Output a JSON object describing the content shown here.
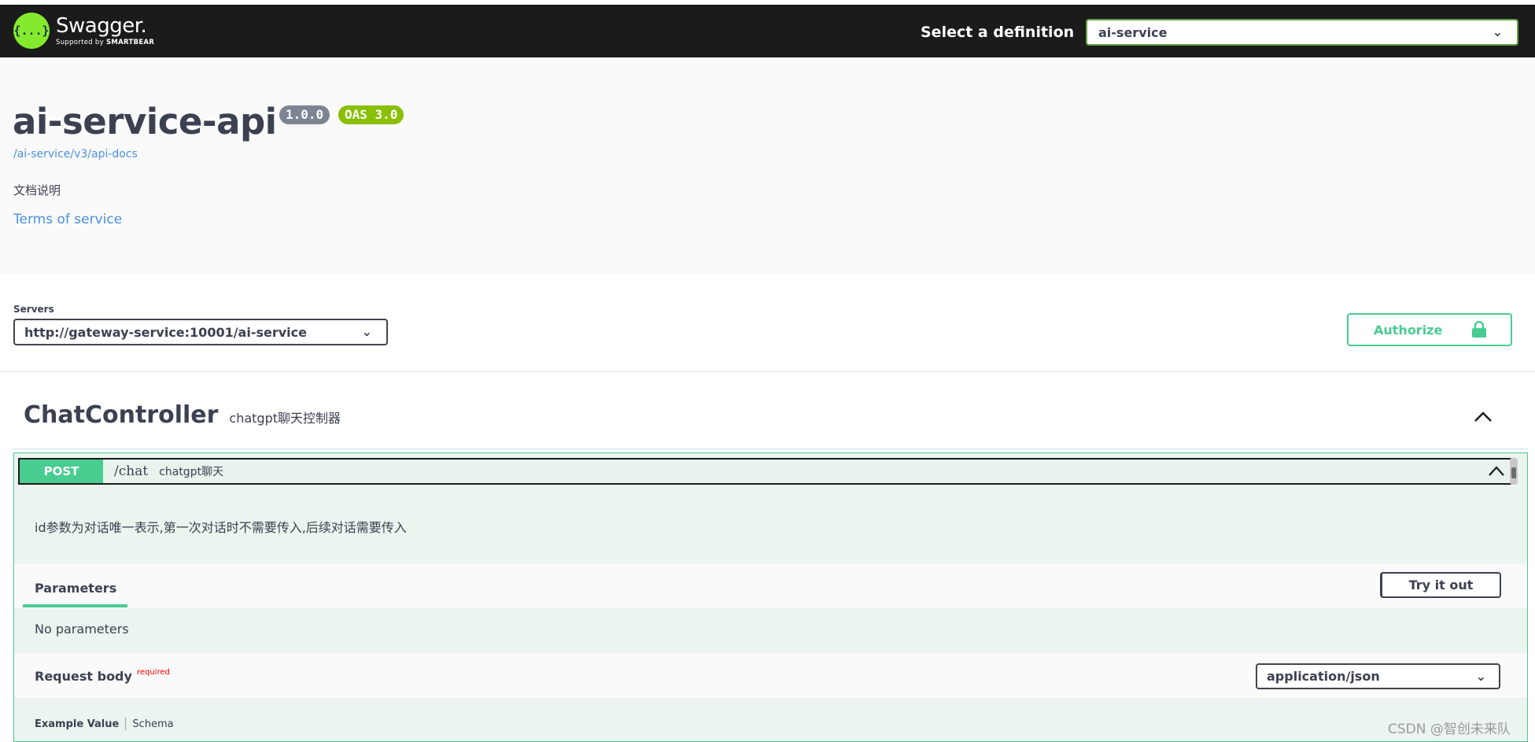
{
  "topbar": {
    "logo_title": "Swagger.",
    "logo_sub_prefix": "Supported by ",
    "logo_sub_brand": "SMARTBEAR",
    "logo_glyph": "{...}",
    "definition_label": "Select a definition",
    "definition_value": "ai-service",
    "accent_color": "#85ea2d"
  },
  "info": {
    "title": "ai-service-api",
    "version": "1.0.0",
    "oas": "OAS 3.0",
    "url": "/ai-service/v3/api-docs",
    "description": "文档说明",
    "terms": "Terms of service"
  },
  "servers": {
    "label": "Servers",
    "selected": "http://gateway-service:10001/ai-service",
    "authorize_label": "Authorize"
  },
  "tag": {
    "name": "ChatController",
    "description": "chatgpt聊天控制器"
  },
  "operation": {
    "method": "POST",
    "path": "/chat",
    "summary": "chatgpt聊天",
    "description": "id参数为对话唯一表示,第一次对话时不需要传入,后续对话需要传入",
    "method_color": "#49cc90",
    "parameters_tab": "Parameters",
    "try_button": "Try it out",
    "no_parameters": "No parameters",
    "request_body_label": "Request body",
    "required_label": "required",
    "content_type": "application/json",
    "example_value_tab": "Example Value",
    "schema_tab": "Schema"
  },
  "watermark": "CSDN @智创未来队"
}
